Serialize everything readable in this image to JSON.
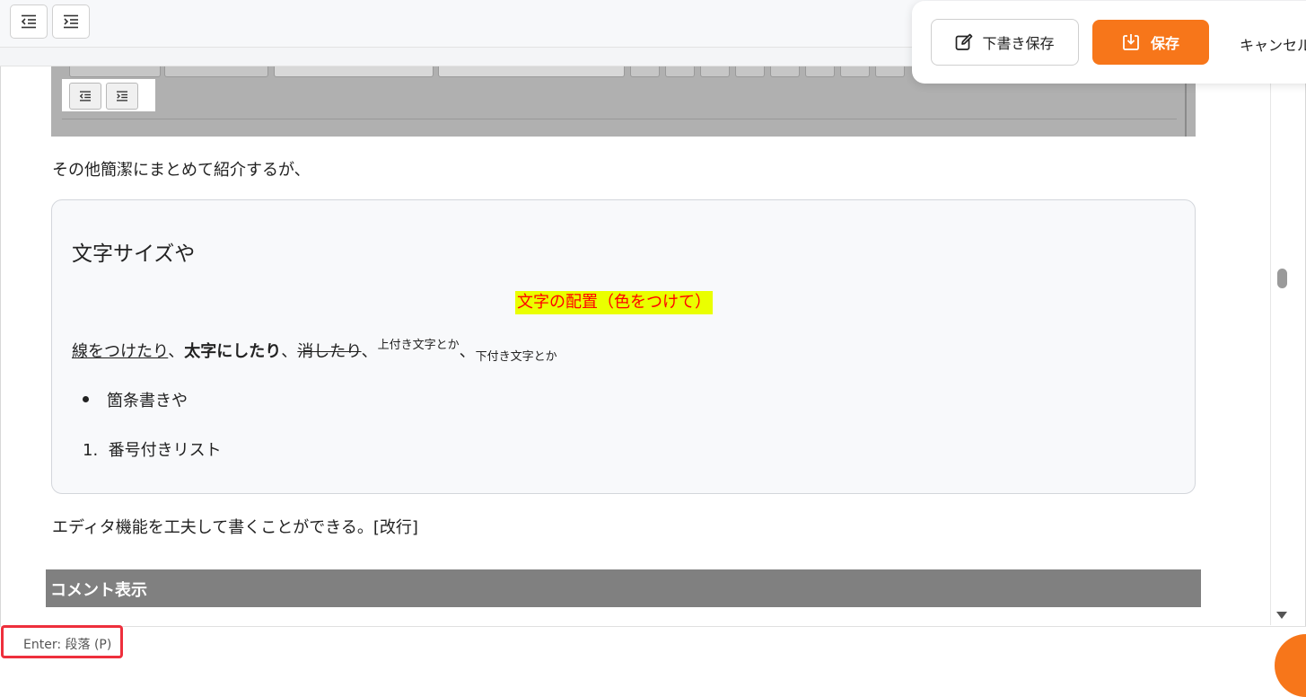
{
  "toolbar": {
    "outdent_icon": "outdent-icon",
    "indent_icon": "indent-icon"
  },
  "actions": {
    "draft_label": "下書き保存",
    "save_label": "保存",
    "cancel_label": "キャンセル",
    "accent_color": "#f7761a"
  },
  "content": {
    "intro": "その他簡潔にまとめて紹介するが、",
    "card": {
      "heading": "文字サイズや",
      "highlight": "文字の配置（色をつけて）",
      "highlight_bg": "#eaff00",
      "highlight_color": "#ff0000",
      "underline": "線をつけたり",
      "sep1": "、",
      "bold": "太字にしたり",
      "sep2": "、",
      "strike": "消したり",
      "sep3": "、",
      "superscript": "上付き文字とか",
      "sep4": "、",
      "subscript": "下付き文字とか",
      "bullet_item": "箇条書きや",
      "ordered_marker": "1.",
      "ordered_item": "番号付きリスト"
    },
    "outro": "エディタ機能を工夫して書くことができる。[改行]",
    "comment_heading": "コメント表示"
  },
  "status": {
    "enter_hint": "Enter: 段落 (P)",
    "highlight_color": "#ee2f3c"
  }
}
